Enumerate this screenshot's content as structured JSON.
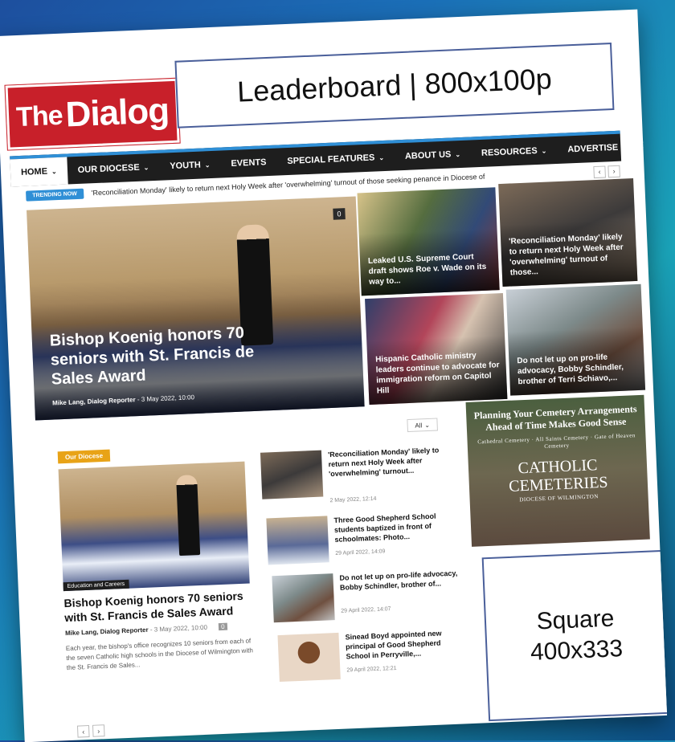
{
  "header": {
    "logo_the": "The",
    "logo_name": "Dialog",
    "leaderboard": "Leaderboard | 800x100p"
  },
  "nav": {
    "items": [
      {
        "label": "HOME",
        "chev": "⌄"
      },
      {
        "label": "OUR DIOCESE",
        "chev": "⌄"
      },
      {
        "label": "YOUTH",
        "chev": "⌄"
      },
      {
        "label": "EVENTS",
        "chev": ""
      },
      {
        "label": "SPECIAL FEATURES",
        "chev": "⌄"
      },
      {
        "label": "ABOUT US",
        "chev": "⌄"
      },
      {
        "label": "RESOURCES",
        "chev": "⌄"
      },
      {
        "label": "ADVERTISE",
        "chev": ""
      }
    ],
    "search_icon": "search-icon"
  },
  "trending": {
    "badge": "TRENDING NOW",
    "text": "'Reconciliation Monday' likely to return next Holy Week after 'overwhelming' turnout of those seeking penance in Diocese of",
    "prev": "‹",
    "next": "›"
  },
  "hero": {
    "count": "0",
    "title": "Bishop Koenig honors 70 seniors with St. Francis de Sales Award",
    "author": "Mike Lang, Dialog Reporter",
    "date": "- 3 May 2022, 10:00"
  },
  "tiles": [
    "Leaked U.S. Supreme Court draft shows Roe v. Wade on its way to...",
    "'Reconciliation Monday' likely to return next Holy Week after 'overwhelming' turnout of those...",
    "Hispanic Catholic ministry leaders continue to advocate for immigration reform on Capitol Hill",
    "Do not let up on pro-life advocacy, Bobby Schindler, brother of Terri Schiavo,..."
  ],
  "section": {
    "filter": "All",
    "category_badge": "Our Diocese",
    "image_tag": "Education and Careers",
    "title": "Bishop Koenig honors 70 seniors with St. Francis de Sales Award",
    "author": "Mike Lang, Dialog Reporter",
    "date": "- 3 May 2022, 10:00",
    "count": "0",
    "excerpt": "Each year, the bishop's office recognizes 10 seniors from each of the seven Catholic high schools in the Diocese of Wilmington with the St. Francis de Sales...",
    "prev": "‹",
    "next": "›"
  },
  "list": [
    {
      "title": "'Reconciliation Monday' likely to return next Holy Week after 'overwhelming' turnout...",
      "date": "2 May 2022, 12:14"
    },
    {
      "title": "Three Good Shepherd School students baptized in front of schoolmates: Photo...",
      "date": "29 April 2022, 14:09"
    },
    {
      "title": "Do not let up on pro-life advocacy, Bobby Schindler, brother of...",
      "date": "29 April 2022, 14:07"
    },
    {
      "title": "Sinead Boyd appointed new principal of Good Shepherd School in Perryville,...",
      "date": "29 April 2022, 12:21"
    }
  ],
  "ad": {
    "line1": "Planning Your Cemetery Arrangements Ahead of Time Makes Good Sense",
    "line2": "Cathedral Cemetery · All Saints Cemetery · Gate of Heaven Cemetery",
    "line3": "CATHOLIC CEMETERIES",
    "line4": "DIOCESE OF WILMINGTON"
  },
  "square": {
    "line1": "Square",
    "line2": "400x333"
  }
}
